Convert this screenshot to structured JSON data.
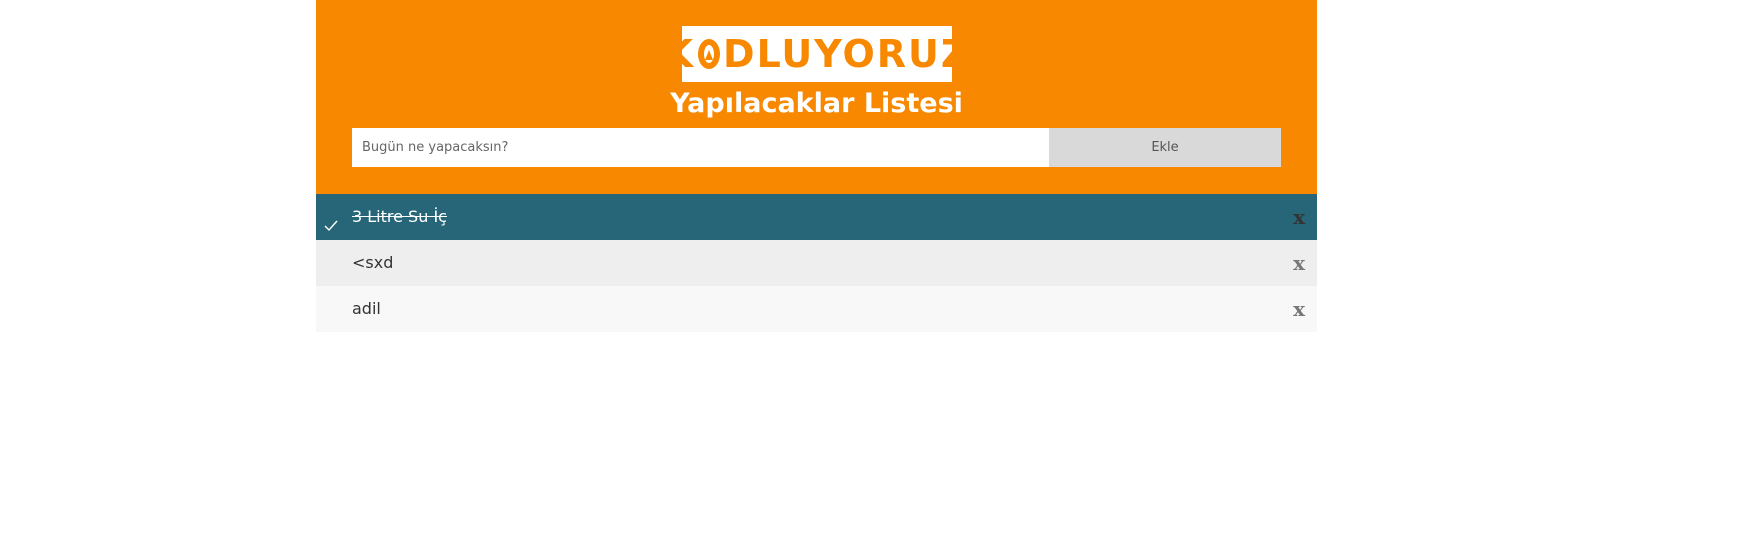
{
  "header": {
    "logo_text": "KODLUYORUZ",
    "title": "Yapılacaklar Listesi"
  },
  "form": {
    "input_placeholder": "Bugün ne yapacaksın?",
    "input_value": "",
    "add_label": "Ekle"
  },
  "tasks": [
    {
      "text": "3 Litre Su İç",
      "checked": true,
      "close_label": "x"
    },
    {
      "text": "<sxd",
      "checked": false,
      "close_label": "x"
    },
    {
      "text": "adil",
      "checked": false,
      "close_label": "x"
    }
  ],
  "colors": {
    "header_bg": "#f78800",
    "checked_bg": "#276678",
    "button_bg": "#d9d9d9"
  },
  "icons": [
    "logo-icon",
    "check-icon",
    "close-icon"
  ]
}
